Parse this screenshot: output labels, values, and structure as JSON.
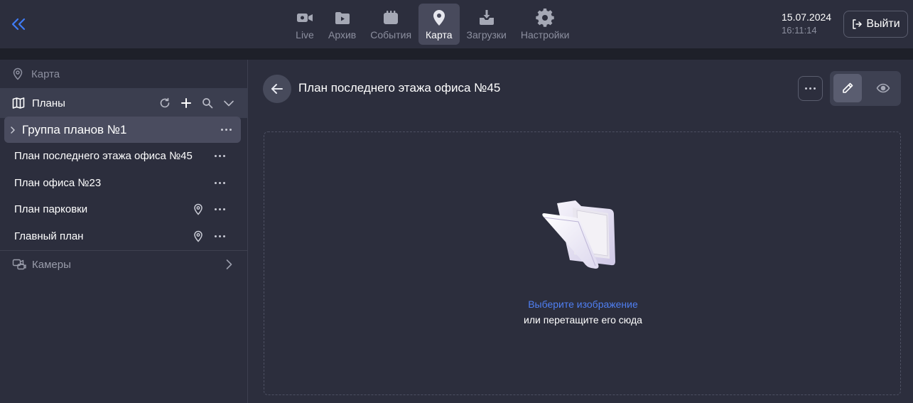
{
  "topbar": {
    "nav": [
      {
        "label": "Live",
        "icon": "video-camera-icon"
      },
      {
        "label": "Архив",
        "icon": "archive-folder-icon"
      },
      {
        "label": "События",
        "icon": "events-icon"
      },
      {
        "label": "Карта",
        "icon": "map-pin-icon",
        "active": true
      },
      {
        "label": "Загрузки",
        "icon": "download-icon"
      },
      {
        "label": "Настройки",
        "icon": "gear-icon"
      }
    ],
    "date": "15.07.2024",
    "time": "16:11:14",
    "logout_label": "Выйти"
  },
  "sidebar": {
    "map_label": "Карта",
    "plans_label": "Планы",
    "group": {
      "label": "Группа планов №1"
    },
    "items": [
      {
        "label": "План последнего этажа офиса №45",
        "pinned": false
      },
      {
        "label": "План офиса №23",
        "pinned": false
      },
      {
        "label": "План парковки",
        "pinned": true
      },
      {
        "label": "Главный план",
        "pinned": true
      }
    ],
    "cameras_label": "Камеры"
  },
  "main": {
    "title": "План последнего этажа офиса №45",
    "dropzone": {
      "link_text": "Выберите изображение",
      "hint_text": "или перетащите его сюда"
    }
  },
  "colors": {
    "accent": "#3f7cf7",
    "background": "#2c2e3d",
    "active_tab": "#484a5c"
  }
}
